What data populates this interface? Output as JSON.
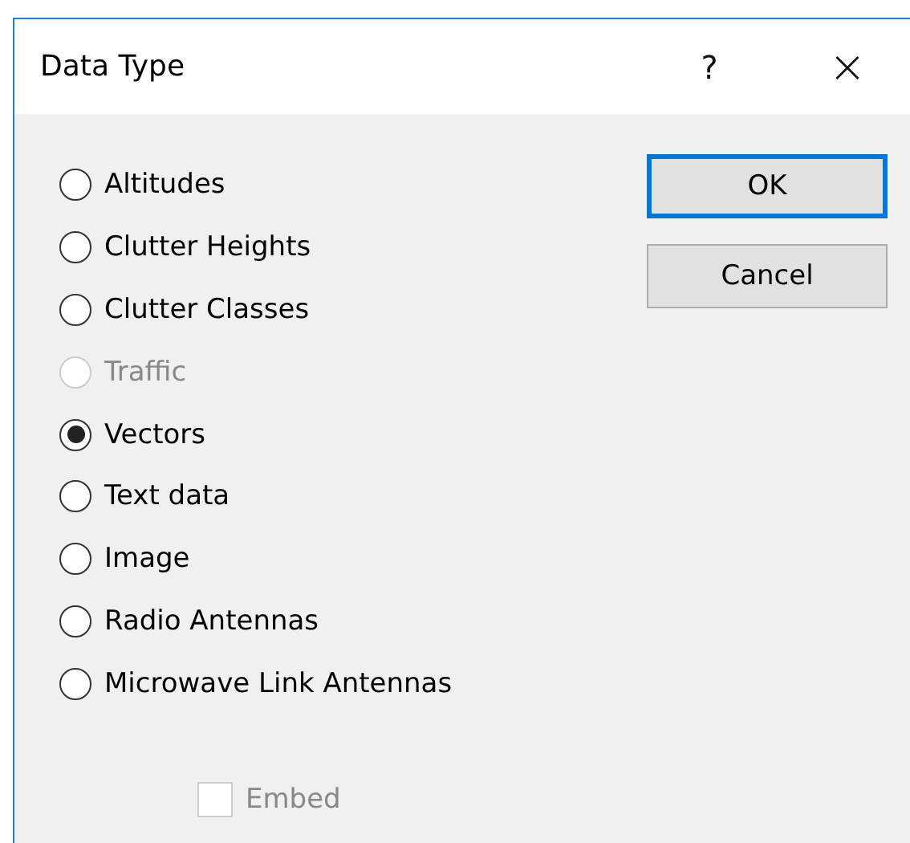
{
  "window": {
    "title": "Data Type",
    "help": "?",
    "close": "×"
  },
  "options": [
    {
      "label": "Altitudes",
      "selected": false,
      "disabled": false
    },
    {
      "label": "Clutter Heights",
      "selected": false,
      "disabled": false
    },
    {
      "label": "Clutter Classes",
      "selected": false,
      "disabled": false
    },
    {
      "label": "Traffic",
      "selected": false,
      "disabled": true
    },
    {
      "label": "Vectors",
      "selected": true,
      "disabled": false
    },
    {
      "label": "Text data",
      "selected": false,
      "disabled": false
    },
    {
      "label": "Image",
      "selected": false,
      "disabled": false
    },
    {
      "label": "Radio Antennas",
      "selected": false,
      "disabled": false
    },
    {
      "label": "Microwave Link Antennas",
      "selected": false,
      "disabled": false
    }
  ],
  "buttons": [
    {
      "label": "OK",
      "default": true
    },
    {
      "label": "Cancel",
      "default": false
    }
  ],
  "embed": {
    "label": "Embed",
    "checked": false,
    "disabled": true
  }
}
